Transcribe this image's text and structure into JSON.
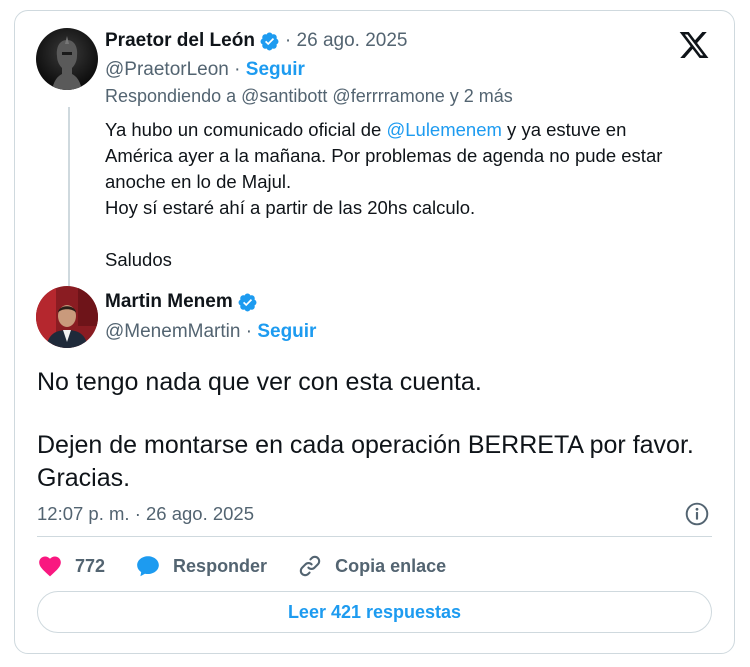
{
  "brand": {
    "logo": "x-logo-icon",
    "accent": "#1d9bf0",
    "like_color": "#f91880"
  },
  "reply_tweet": {
    "author_name": "Praetor del León",
    "date": "· 26 ago. 2025",
    "handle": "@PraetorLeon",
    "separator": " · ",
    "follow_label": "Seguir",
    "replying_to": "Respondiendo a @santibott @ferrrramone y 2 más",
    "text": {
      "line1_pre": "Ya hubo un comunicado oficial de ",
      "mention": "@Lulemenem",
      "line1_post": " y ya estuve en",
      "line2": "América ayer a la mañana. Por problemas de agenda no pude estar",
      "line3": "anoche en lo de Majul.",
      "line4": "Hoy sí estaré ahí a partir de las 20hs calculo.",
      "line5": "Saludos"
    }
  },
  "main_tweet": {
    "author_name": "Martin Menem",
    "handle": "@MenemMartin",
    "separator": " · ",
    "follow_label": "Seguir",
    "text_line1": "No tengo nada que ver con esta cuenta.",
    "text_line2": "Dejen de montarse en cada operación BERRETA por favor.",
    "text_line3": "Gracias.",
    "timestamp": "12:07 p. m. · 26 ago. 2025"
  },
  "actions": {
    "like_count": "772",
    "reply_label": "Responder",
    "copy_label": "Copia enlace"
  },
  "read_replies_label": "Leer 421 respuestas"
}
